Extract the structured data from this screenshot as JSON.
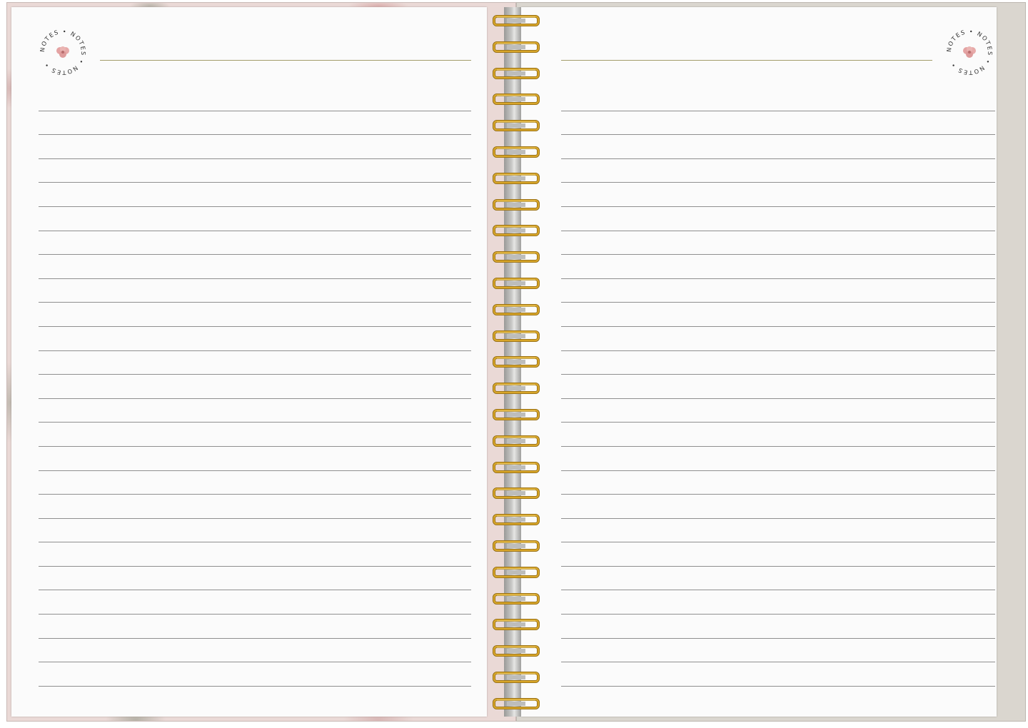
{
  "notebook": {
    "badge_text": "NOTES • NOTES • NOTES •",
    "ring_count": 27,
    "rule_count": 25,
    "colors": {
      "cover_left": "#ead9d6",
      "cover_right": "#dad6cf",
      "paper": "#fbfbfb",
      "rule": "#8f8f8f",
      "title_line": "#a29d6a",
      "ring_gold": "#d8a62a",
      "flower": "#e4a3a3"
    },
    "icons": {
      "badge": "notes-badge-icon",
      "flower": "flower-icon",
      "ring": "spiral-ring-icon"
    }
  }
}
